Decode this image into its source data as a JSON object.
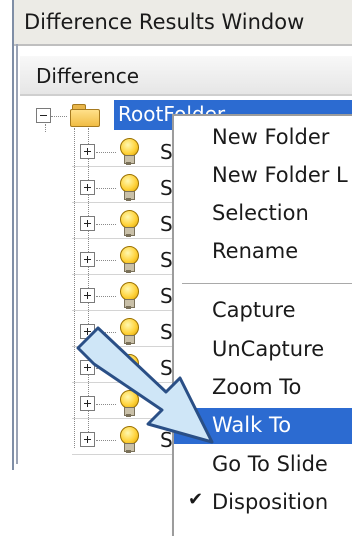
{
  "window": {
    "title": "Difference Results Window"
  },
  "tree": {
    "column_header": "Difference",
    "root": {
      "label": "RootFolder"
    },
    "children": [
      {
        "label": "S"
      },
      {
        "label": "S"
      },
      {
        "label": "S"
      },
      {
        "label": "S"
      },
      {
        "label": "S"
      },
      {
        "label": "S"
      },
      {
        "label": "S"
      },
      {
        "label": "S"
      },
      {
        "label": "S"
      }
    ]
  },
  "context_menu": {
    "items": [
      {
        "label": "New Folder"
      },
      {
        "label": "New Folder L"
      },
      {
        "label": "Selection"
      },
      {
        "label": "Rename"
      },
      {
        "label": "Capture"
      },
      {
        "label": "UnCapture"
      },
      {
        "label": "Zoom To"
      },
      {
        "label": "Walk To",
        "highlighted": true
      },
      {
        "label": "Go To Slide"
      },
      {
        "label": "Disposition",
        "checked": true
      }
    ],
    "check_glyph": "✔"
  },
  "colors": {
    "selection": "#2c6bd1",
    "callout_arrow_fill": "#cfe6f7",
    "callout_arrow_stroke": "#2a4f86"
  },
  "icons": [
    "collapse-icon",
    "expand-icon",
    "folder-icon",
    "light-bulb-icon",
    "checkmark-icon",
    "callout-arrow"
  ]
}
